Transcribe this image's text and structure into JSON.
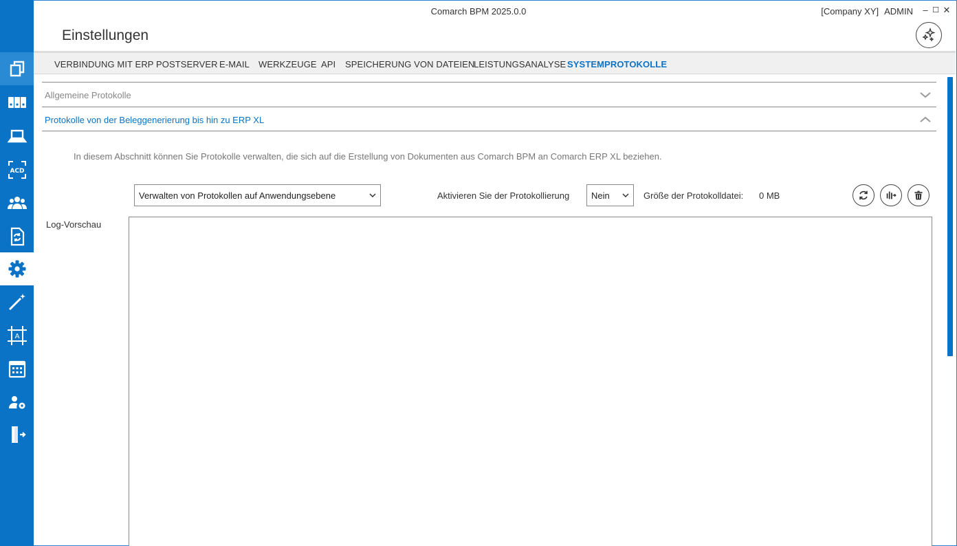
{
  "window": {
    "app_title": "Comarch BPM 2025.0.0",
    "company": "[Company XY]",
    "user": "ADMIN",
    "minimize_glyph": "–",
    "maximize_glyph": "☐",
    "close_glyph": "✕"
  },
  "page": {
    "title": "Einstellungen"
  },
  "sidebar": {
    "accent_color": "#0a73c6",
    "items": [
      {
        "icon": "documents-icon",
        "state": "shaded"
      },
      {
        "icon": "binders-icon",
        "state": "normal"
      },
      {
        "icon": "laptop-icon",
        "state": "normal"
      },
      {
        "icon": "acd-scan-icon",
        "state": "normal"
      },
      {
        "icon": "users-group-icon",
        "state": "normal"
      },
      {
        "icon": "document-sync-icon",
        "state": "normal"
      },
      {
        "icon": "gear-icon",
        "state": "active"
      },
      {
        "icon": "magic-wand-icon",
        "state": "normal"
      },
      {
        "icon": "text-frame-icon",
        "state": "normal"
      },
      {
        "icon": "calendar-icon",
        "state": "normal"
      },
      {
        "icon": "user-settings-icon",
        "state": "normal"
      },
      {
        "icon": "exit-door-icon",
        "state": "normal"
      }
    ]
  },
  "tabs": [
    {
      "label": "VERBINDUNG MIT ERP",
      "active": false
    },
    {
      "label": "POSTSERVER",
      "active": false
    },
    {
      "label": "E-MAIL",
      "active": false
    },
    {
      "label": "WERKZEUGE",
      "active": false
    },
    {
      "label": "API",
      "active": false
    },
    {
      "label": "SPEICHERUNG VON DATEIEN",
      "active": false
    },
    {
      "label": "LEISTUNGSANALYSE",
      "active": false
    },
    {
      "label": "SYSTEMPROTOKOLLE",
      "active": true
    }
  ],
  "sections": {
    "general": {
      "title": "Allgemeine Protokolle",
      "expanded": false
    },
    "erp": {
      "title": "Protokolle von der Beleggenerierung bis hin zu ERP XL",
      "expanded": true
    }
  },
  "erp_section": {
    "description": "In diesem Abschnitt können Sie Protokolle verwalten, die sich auf die Erstellung von Dokumenten aus Comarch BPM an Comarch ERP XL beziehen.",
    "level_select": {
      "value": "Verwalten von Protokollen auf Anwendungsebene"
    },
    "logging_label": "Aktivieren Sie der Protokollierung",
    "logging_select": {
      "value": "Nein"
    },
    "file_size_label": "Größe der Protokolldatei:",
    "file_size_value": "0 MB",
    "buttons": {
      "refresh": "refresh-icon",
      "export": "export-log-icon",
      "delete": "trash-icon"
    },
    "preview_label": "Log-Vorschau",
    "preview_content": ""
  }
}
